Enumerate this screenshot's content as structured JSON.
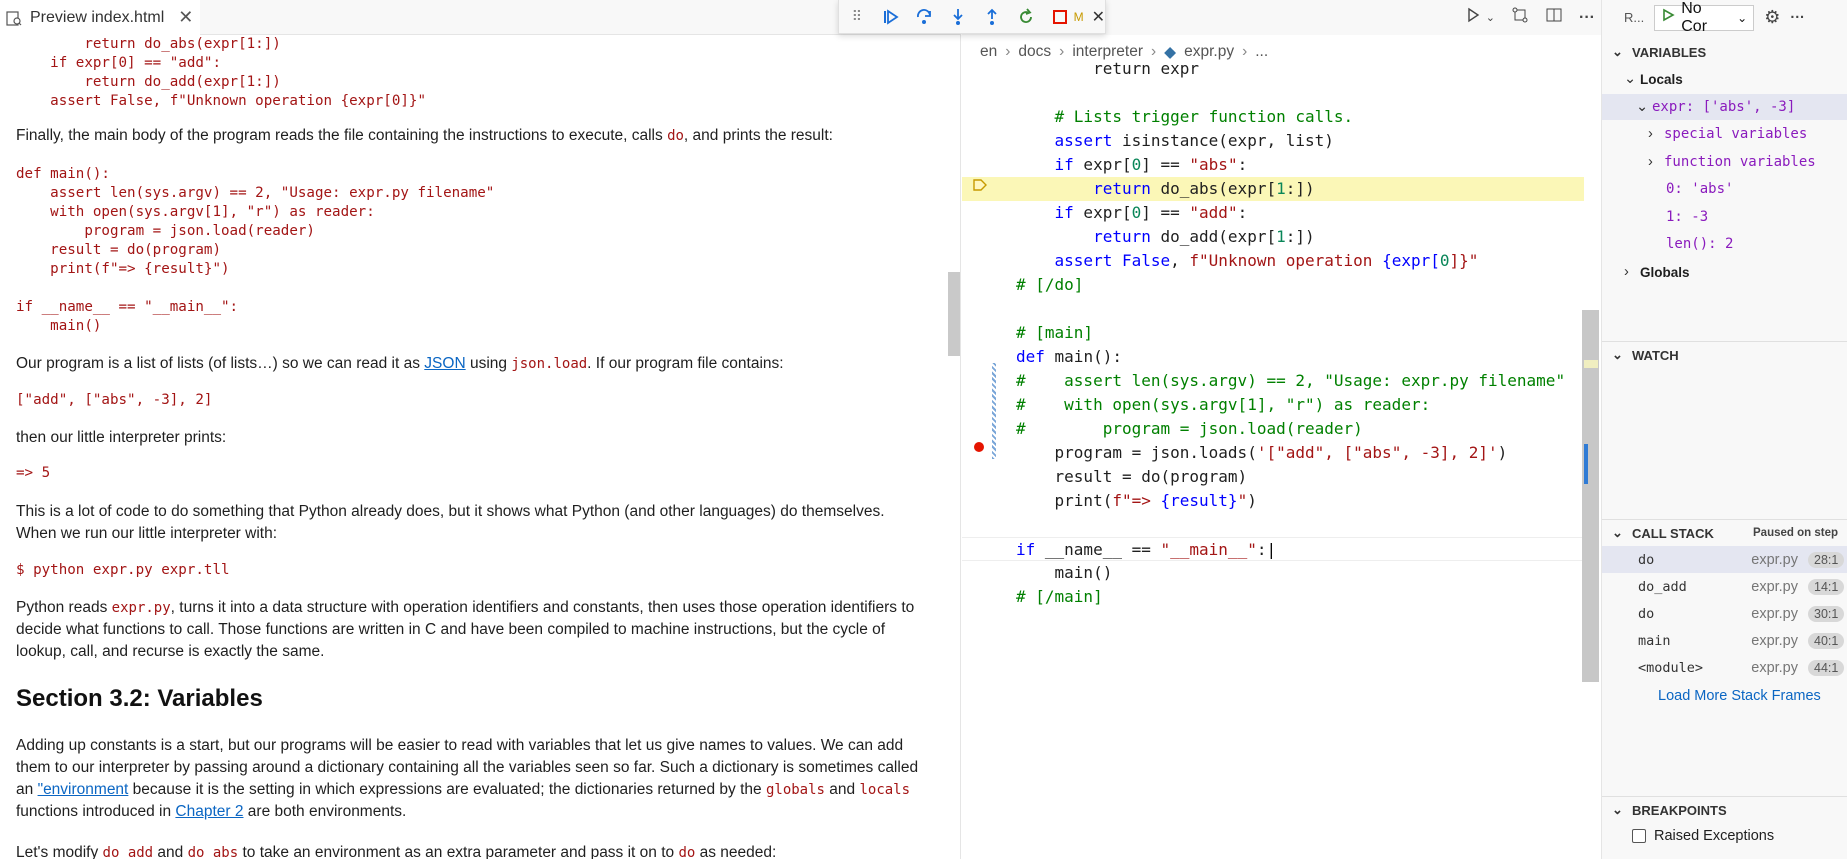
{
  "preview": {
    "tab_title": "Preview index.html",
    "code_top": "        return do_abs(expr[1:])\n    if expr[0] == \"add\":\n        return do_add(expr[1:])\n    assert False, f\"Unknown operation {expr[0]}\"",
    "para1_a": "Finally, the main body of the program reads the file containing the instructions to execute, calls ",
    "para1_code": "do",
    "para1_b": ", and prints the result:",
    "code_main": "def main():\n    assert len(sys.argv) == 2, \"Usage: expr.py filename\"\n    with open(sys.argv[1], \"r\") as reader:\n        program = json.load(reader)\n    result = do(program)\n    print(f\"=> {result}\")\n\nif __name__ == \"__main__\":\n    main()",
    "para2_a": "Our program is a list of lists (of lists…) so we can read it as ",
    "para2_link": "JSON",
    "para2_b": " using ",
    "para2_code": "json.load",
    "para2_c": ". If our program file contains:",
    "code_json": "[\"add\", [\"abs\", -3], 2]",
    "para3": "then our little interpreter prints:",
    "code_out": "=> 5",
    "para4": "This is a lot of code to do something that Python already does, but it shows what Python (and other languages) do themselves. When we run our little interpreter with:",
    "code_cmd": "$ python expr.py expr.tll",
    "para5_a": "Python reads ",
    "para5_code": "expr.py",
    "para5_b": ", turns it into a data structure with operation identifiers and constants, then uses those operation identifiers to decide what functions to call. Those functions are written in C and have been compiled to machine instructions, but the cycle of lookup, call, and recurse is exactly the same.",
    "heading": "Section 3.2: Variables",
    "para6_a": "Adding up constants is a start, but our programs will be easier to read with variables that let us give names to values. We can add them to our interpreter by passing around a dictionary containing all the variables seen so far. Such a dictionary is sometimes called an ",
    "para6_link": "\"environment",
    "para6_b": " because it is the setting in which expressions are evaluated; the dictionaries returned by the ",
    "para6_code1": "globals",
    "para6_c": " and ",
    "para6_code2": "locals",
    "para6_d": " functions introduced in ",
    "para6_link2": "Chapter 2",
    "para6_e": " are both environments.",
    "para7_a": "Let's modify ",
    "para7_code1": "do_add",
    "para7_b": " and ",
    "para7_code2": "do_abs",
    "para7_c": " to take an environment as an extra parameter and pass it on to ",
    "para7_code3": "do",
    "para7_d": " as needed:"
  },
  "debug_toolbar": {
    "icons": [
      "grip-icon",
      "continue-icon",
      "step-over-icon",
      "step-into-icon",
      "step-out-icon",
      "restart-icon",
      "stop-icon"
    ],
    "overflow_text": "M",
    "close": "✕"
  },
  "editor": {
    "breadcrumb": [
      "en",
      "docs",
      "interpreter",
      "expr.py",
      "..."
    ],
    "lines": [
      {
        "html_parts": [
          [
            "        ",
            ""
          ],
          [
            "return expr",
            "fn"
          ]
        ]
      },
      {
        "html_parts": [
          [
            "",
            ""
          ]
        ]
      },
      {
        "html_parts": [
          [
            "    ",
            ""
          ],
          [
            "# Lists trigger function calls.",
            "cm"
          ]
        ]
      },
      {
        "html_parts": [
          [
            "    ",
            ""
          ],
          [
            "assert",
            "kw"
          ],
          [
            " isinstance(expr, list)",
            "fn"
          ]
        ]
      },
      {
        "html_parts": [
          [
            "    ",
            ""
          ],
          [
            "if",
            "kw"
          ],
          [
            " expr[",
            "fn"
          ],
          [
            "0",
            "num"
          ],
          [
            "] == ",
            "fn"
          ],
          [
            "\"abs\"",
            "str"
          ],
          [
            ":",
            "fn"
          ]
        ]
      },
      {
        "html_parts": [
          [
            "        ",
            ""
          ],
          [
            "return",
            "kw"
          ],
          [
            " do_abs(expr[",
            "fn"
          ],
          [
            "1",
            "num"
          ],
          [
            ":]",
            "fn"
          ],
          [
            ")",
            "fn"
          ]
        ]
      },
      {
        "html_parts": [
          [
            "    ",
            ""
          ],
          [
            "if",
            "kw"
          ],
          [
            " expr[",
            "fn"
          ],
          [
            "0",
            "num"
          ],
          [
            "] == ",
            "fn"
          ],
          [
            "\"add\"",
            "str"
          ],
          [
            ":",
            "fn"
          ]
        ]
      },
      {
        "html_parts": [
          [
            "        ",
            ""
          ],
          [
            "return",
            "kw"
          ],
          [
            " do_add(expr[",
            "fn"
          ],
          [
            "1",
            "num"
          ],
          [
            ":]",
            "fn"
          ],
          [
            ")",
            "fn"
          ]
        ]
      },
      {
        "html_parts": [
          [
            "    ",
            ""
          ],
          [
            "assert",
            "kw"
          ],
          [
            " ",
            "fn"
          ],
          [
            "False",
            "kw"
          ],
          [
            ", ",
            "fn"
          ],
          [
            "f\"Unknown operation ",
            "str"
          ],
          [
            "{expr[",
            "kw"
          ],
          [
            "0",
            "num"
          ],
          [
            "]}\"",
            "str"
          ]
        ]
      },
      {
        "html_parts": [
          [
            "# [/do]",
            "cm"
          ]
        ]
      },
      {
        "html_parts": [
          [
            "",
            ""
          ]
        ]
      },
      {
        "html_parts": [
          [
            "# [main]",
            "cm"
          ]
        ]
      },
      {
        "html_parts": [
          [
            "def",
            "kw"
          ],
          [
            " main():",
            "fn"
          ]
        ]
      },
      {
        "html_parts": [
          [
            "#    assert len(sys.argv) == 2, \"Usage: expr.py filename\"",
            "cm"
          ]
        ]
      },
      {
        "html_parts": [
          [
            "#    with open(sys.argv[1], \"r\") as reader:",
            "cm"
          ]
        ]
      },
      {
        "html_parts": [
          [
            "#        program = json.load(reader)",
            "cm"
          ]
        ]
      },
      {
        "html_parts": [
          [
            "    ",
            ""
          ],
          [
            "program = json.loads(",
            "fn"
          ],
          [
            "'[\"add\", [\"abs\", -3], 2]'",
            "str"
          ],
          [
            ")",
            "fn"
          ]
        ]
      },
      {
        "html_parts": [
          [
            "    ",
            ""
          ],
          [
            "result = do(program)",
            "fn"
          ]
        ]
      },
      {
        "html_parts": [
          [
            "    ",
            ""
          ],
          [
            "print(",
            "fn"
          ],
          [
            "f\"=> ",
            "str"
          ],
          [
            "{result}",
            "kw"
          ],
          [
            "\"",
            "str"
          ],
          [
            ")",
            "fn"
          ]
        ]
      },
      {
        "html_parts": [
          [
            "",
            ""
          ]
        ]
      },
      {
        "html_parts": [
          [
            "if",
            "kw"
          ],
          [
            " __name__ == ",
            "fn"
          ],
          [
            "\"__main__\"",
            "str"
          ],
          [
            ":",
            "fn"
          ]
        ]
      },
      {
        "html_parts": [
          [
            "    ",
            ""
          ],
          [
            "main()",
            "fn"
          ]
        ]
      },
      {
        "html_parts": [
          [
            "# [/main]",
            "cm"
          ]
        ]
      }
    ]
  },
  "sidebar": {
    "run_label": "R...",
    "launch_config": "No Cor",
    "variables_title": "VARIABLES",
    "locals_label": "Locals",
    "expr_label": "expr: ['abs', -3]",
    "special_vars": "special variables",
    "function_vars": "function variables",
    "item0": "0: 'abs'",
    "item1": "1: -3",
    "len_item": "len(): 2",
    "globals_label": "Globals",
    "watch_title": "WATCH",
    "callstack_title": "CALL STACK",
    "callstack_status": "Paused on step",
    "frames": [
      {
        "name": "do",
        "file": "expr.py",
        "pos": "28:1"
      },
      {
        "name": "do_add",
        "file": "expr.py",
        "pos": "14:1"
      },
      {
        "name": "do",
        "file": "expr.py",
        "pos": "30:1"
      },
      {
        "name": "main",
        "file": "expr.py",
        "pos": "40:1"
      },
      {
        "name": "<module>",
        "file": "expr.py",
        "pos": "44:1"
      }
    ],
    "load_more": "Load More Stack Frames",
    "breakpoints_title": "BREAKPOINTS",
    "raised_exceptions": "Raised Exceptions"
  }
}
